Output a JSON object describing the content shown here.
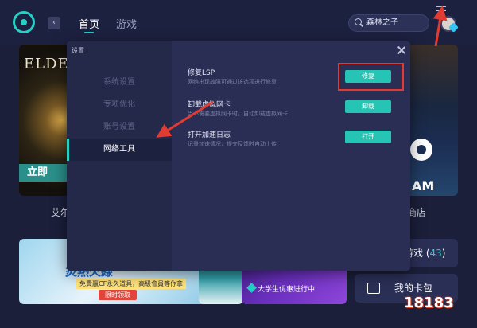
{
  "topbar": {
    "tabs": [
      "首页",
      "游戏"
    ],
    "search_value": "森林之子",
    "back_glyph": "‹"
  },
  "background": {
    "elden_title": "ELDEN",
    "elden_cta": "立即",
    "elden_label": "艾尔",
    "store_label": "商店",
    "steam_text": "AM",
    "banner_title": "炙熱火線",
    "banner_sub": "免費贏CF永久道具，高級會員等你拿",
    "banner_btn": "限时领取",
    "promo_text": "大学生优惠进行中",
    "games_label": "游戏",
    "games_count": "43",
    "cards_label": "我的卡包",
    "watermark": "18183"
  },
  "dialog": {
    "title": "设置",
    "sidebar": [
      {
        "label": "系统设置",
        "active": false
      },
      {
        "label": "专项优化",
        "active": false
      },
      {
        "label": "账号设置",
        "active": false
      },
      {
        "label": "网络工具",
        "active": true
      }
    ],
    "options": [
      {
        "title": "修复LSP",
        "desc": "网络出现故障可通过该选项进行修复",
        "button": "修复"
      },
      {
        "title": "卸载虚拟网卡",
        "desc": "当不需要虚拟网卡时，自动卸载虚拟网卡",
        "button": "卸载"
      },
      {
        "title": "打开加速日志",
        "desc": "记录加速情况，提交反馈时自动上传",
        "button": "打开"
      }
    ]
  },
  "colors": {
    "accent": "#25c4b4",
    "annotation": "#e23b32",
    "dialog_bg": "#2a2e55"
  }
}
